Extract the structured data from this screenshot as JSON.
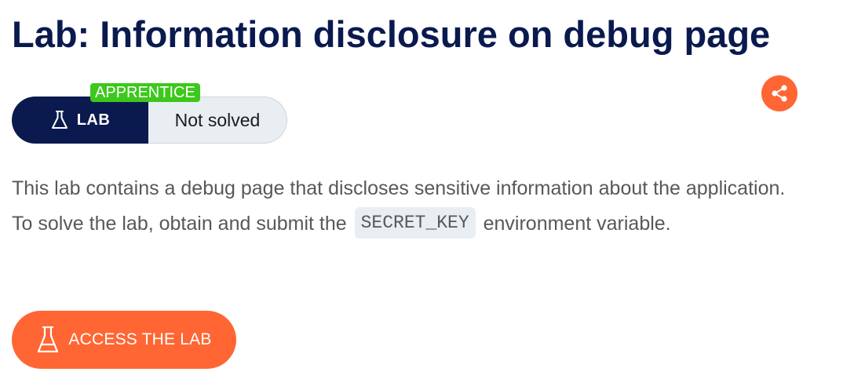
{
  "header": {
    "title": "Lab: Information disclosure on debug page"
  },
  "lab_badge": {
    "level": "APPRENTICE",
    "type_label": "LAB",
    "type_icon": "flask-icon",
    "status": "Not solved"
  },
  "share": {
    "icon": "share-icon"
  },
  "description": {
    "before_code": "This lab contains a debug page that discloses sensitive information about the application. To solve the lab, obtain and submit the",
    "code": "SECRET_KEY",
    "after_code": "environment variable."
  },
  "access_button": {
    "label": "ACCESS THE LAB",
    "icon": "flask-icon"
  },
  "colors": {
    "navy": "#0a1a4e",
    "orange": "#ff6633",
    "green": "#3cc81c",
    "light_gray": "#e9eef2",
    "body_text": "#585858"
  }
}
